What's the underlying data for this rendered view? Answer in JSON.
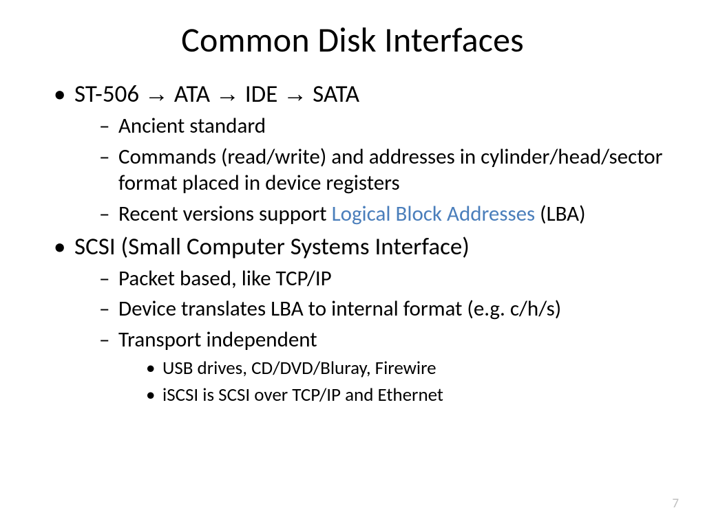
{
  "title": "Common Disk Interfaces",
  "arrow": "→",
  "b1": {
    "seg1": "ST-506 ",
    "seg2": " ATA ",
    "seg3": " IDE ",
    "seg4": " SATA",
    "sub1": "Ancient standard",
    "sub2": "Commands (read/write) and addresses in cylinder/head/sector format placed in device registers",
    "sub3a": "Recent versions support ",
    "sub3link": "Logical Block Addresses",
    "sub3b": " (LBA)"
  },
  "b2": {
    "text": "SCSI (Small Computer Systems Interface)",
    "sub1": "Packet based, like TCP/IP",
    "sub2": "Device translates LBA to internal format (e.g. c/h/s)",
    "sub3": "Transport independent",
    "sub3a": "USB drives, CD/DVD/Bluray, Firewire",
    "sub3b": "iSCSI is SCSI over TCP/IP and Ethernet"
  },
  "page_number": "7"
}
